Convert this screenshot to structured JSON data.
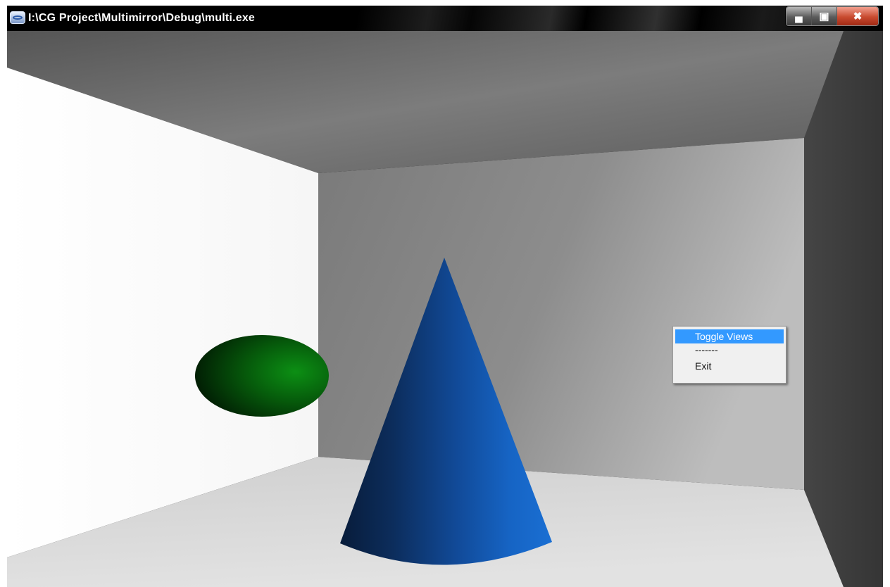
{
  "window": {
    "title": "I:\\CG Project\\Multimirror\\Debug\\multi.exe",
    "icon": "app-window-icon",
    "controls": {
      "minimize": "minimize-icon",
      "maximize": "maximize-icon",
      "close": "close-icon"
    }
  },
  "scene": {
    "objects": [
      "green-ellipsoid",
      "blue-cone"
    ],
    "colors": {
      "sphere": "#0a7a12",
      "cone": "#1565c0",
      "left_wall": "#ffffff",
      "back_wall": "#8e8e8e",
      "ceiling": "#6d6d6d",
      "right_wall": "#3c3c3c",
      "floor": "#d8d8d8"
    }
  },
  "context_menu": {
    "items": [
      {
        "label": "Toggle Views",
        "highlighted": true
      },
      {
        "label": "-------",
        "highlighted": false
      },
      {
        "label": "Exit",
        "highlighted": false
      }
    ]
  }
}
